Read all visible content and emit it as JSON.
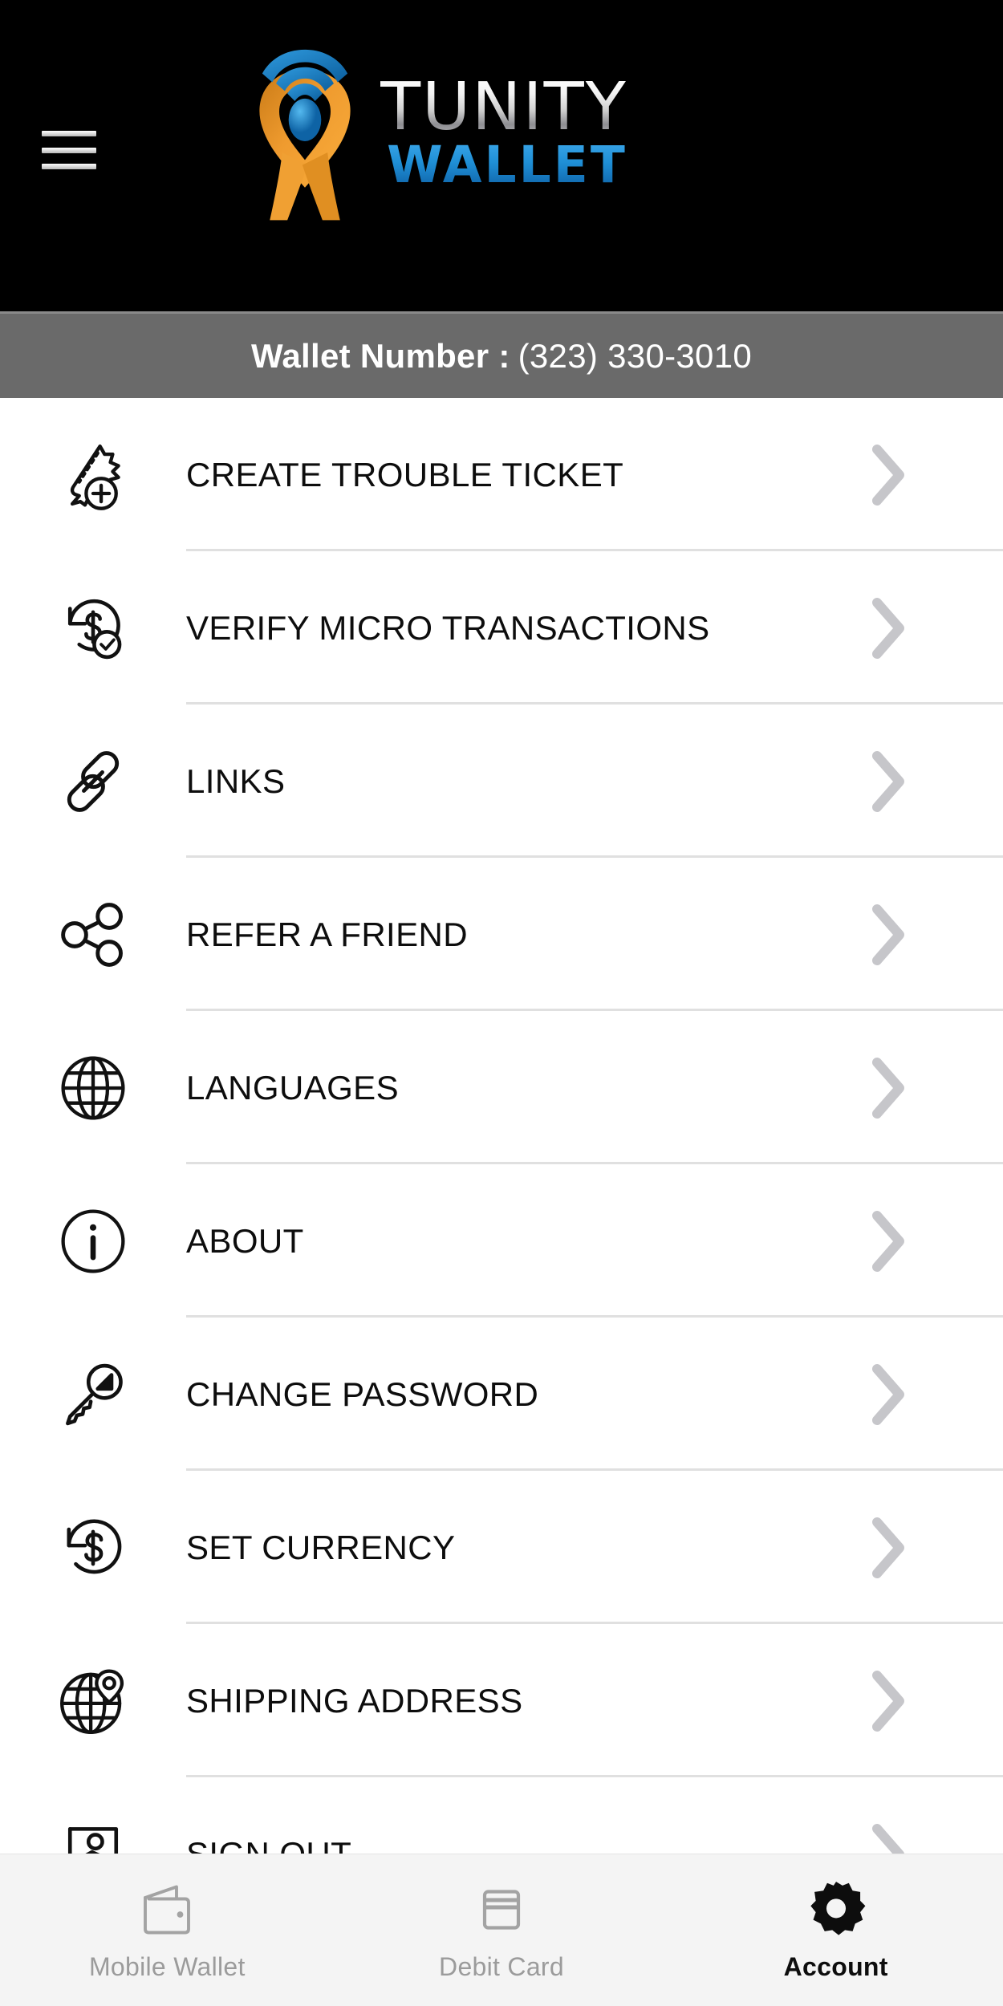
{
  "header": {
    "menu_icon": "hamburger-icon",
    "logo_icon": "tunity-location-pin-logo",
    "brand_primary": "TUNITY",
    "brand_secondary": "WALLET",
    "brand_primary_color": "#d5d5d8",
    "brand_secondary_color": "#1f8fd6",
    "background_color": "#000000"
  },
  "wallet_bar": {
    "label": "Wallet Number :",
    "value": "(323) 330-3010",
    "background_color": "#6a6a6a",
    "text_color": "#ffffff"
  },
  "menu": {
    "chevron_icon": "chevron-right-icon",
    "chevron_color": "#c6c6ca",
    "divider_color": "#e0e0e0",
    "items": [
      {
        "label": "CREATE TROUBLE TICKET",
        "icon": "ticket-add-icon"
      },
      {
        "label": "VERIFY MICRO TRANSACTIONS",
        "icon": "dollar-refresh-check-icon"
      },
      {
        "label": "LINKS",
        "icon": "chain-link-icon"
      },
      {
        "label": "REFER A FRIEND",
        "icon": "share-nodes-icon"
      },
      {
        "label": "LANGUAGES",
        "icon": "globe-icon"
      },
      {
        "label": "ABOUT",
        "icon": "info-circle-icon"
      },
      {
        "label": "CHANGE PASSWORD",
        "icon": "key-icon"
      },
      {
        "label": "SET CURRENCY",
        "icon": "dollar-refresh-icon"
      },
      {
        "label": "SHIPPING ADDRESS",
        "icon": "globe-pin-icon"
      },
      {
        "label": "SIGN OUT",
        "icon": "exit-door-running-icon"
      }
    ]
  },
  "tabbar": {
    "background_color": "#f4f4f4",
    "inactive_color": "#9b9b9b",
    "active_color": "#0d0d0d",
    "tabs": [
      {
        "label": "Mobile Wallet",
        "icon": "wallet-icon",
        "active": false
      },
      {
        "label": "Debit Card",
        "icon": "credit-card-icon",
        "active": false
      },
      {
        "label": "Account",
        "icon": "gear-icon",
        "active": true
      }
    ]
  }
}
